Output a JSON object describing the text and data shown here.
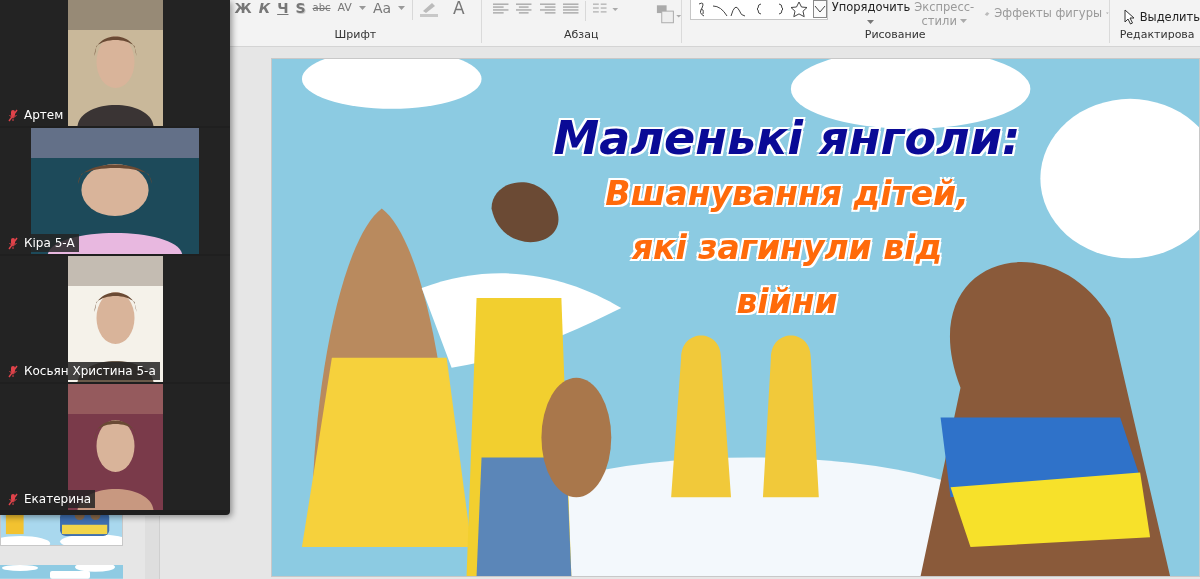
{
  "ribbon": {
    "font_tools": [
      {
        "label": "Ж",
        "kind": "bold"
      },
      {
        "label": "К",
        "kind": "italic"
      },
      {
        "label": "Ч",
        "kind": "underline"
      },
      {
        "label": "S",
        "kind": "shadow"
      },
      {
        "label": "abc",
        "kind": "strike"
      },
      {
        "label": "AV",
        "kind": "spacing"
      },
      {
        "label": "Aa",
        "kind": "case"
      }
    ],
    "font_color": "A",
    "arrange": "Упорядочить",
    "quick_styles": [
      "Экспресс-",
      "стили"
    ],
    "shape_effects": "Эффекты фигуры",
    "select": "Выделить",
    "groups": [
      {
        "label": "Шрифт"
      },
      {
        "label": "Абзац"
      },
      {
        "label": "Рисование"
      },
      {
        "label": "Редактирова"
      }
    ]
  },
  "participants": [
    {
      "name": "Артем",
      "muted": true
    },
    {
      "name": "Кіра 5-А",
      "muted": true
    },
    {
      "name": "Косьян Христина 5-а",
      "muted": true
    },
    {
      "name": "Екатерина",
      "muted": true
    }
  ],
  "slide": {
    "title": "Маленькі янголи:",
    "subtitle_lines": [
      "Вшанування дітей,",
      "які загинули від",
      "війни"
    ]
  }
}
